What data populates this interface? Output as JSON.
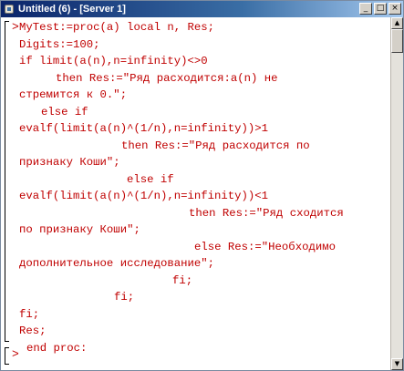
{
  "window": {
    "title": "Untitled (6) - [Server 1]",
    "controls": {
      "minimize": "_",
      "restore": "□",
      "close": "×"
    }
  },
  "prompt_symbol": ">",
  "code_lines": [
    "MyTest:=proc(a) local n, Res;",
    "Digits:=100;",
    "if limit(a(n),n=infinity)<>0",
    "then Res:=\"Ряд расходится:a(n) не",
    "стремится к 0.\";",
    "else if",
    "evalf(limit(a(n)^(1/n),n=infinity))>1",
    "then Res:=\"Ряд расходится по",
    "признаку Коши\";",
    "else if",
    "evalf(limit(a(n)^(1/n),n=infinity))<1",
    "then Res:=\"Ряд сходится",
    "по признаку Коши\";",
    "else Res:=\"Необходимо",
    "дополнительное исследование\";",
    "fi;",
    "fi;",
    "fi;",
    "Res;",
    "end proc:"
  ],
  "colors": {
    "input_text": "#c00000",
    "titlebar_start": "#0a246a",
    "titlebar_end": "#a6caf0"
  },
  "icons": {
    "app": "maple-worksheet-icon",
    "scroll_up": "▲",
    "scroll_down": "▼"
  }
}
